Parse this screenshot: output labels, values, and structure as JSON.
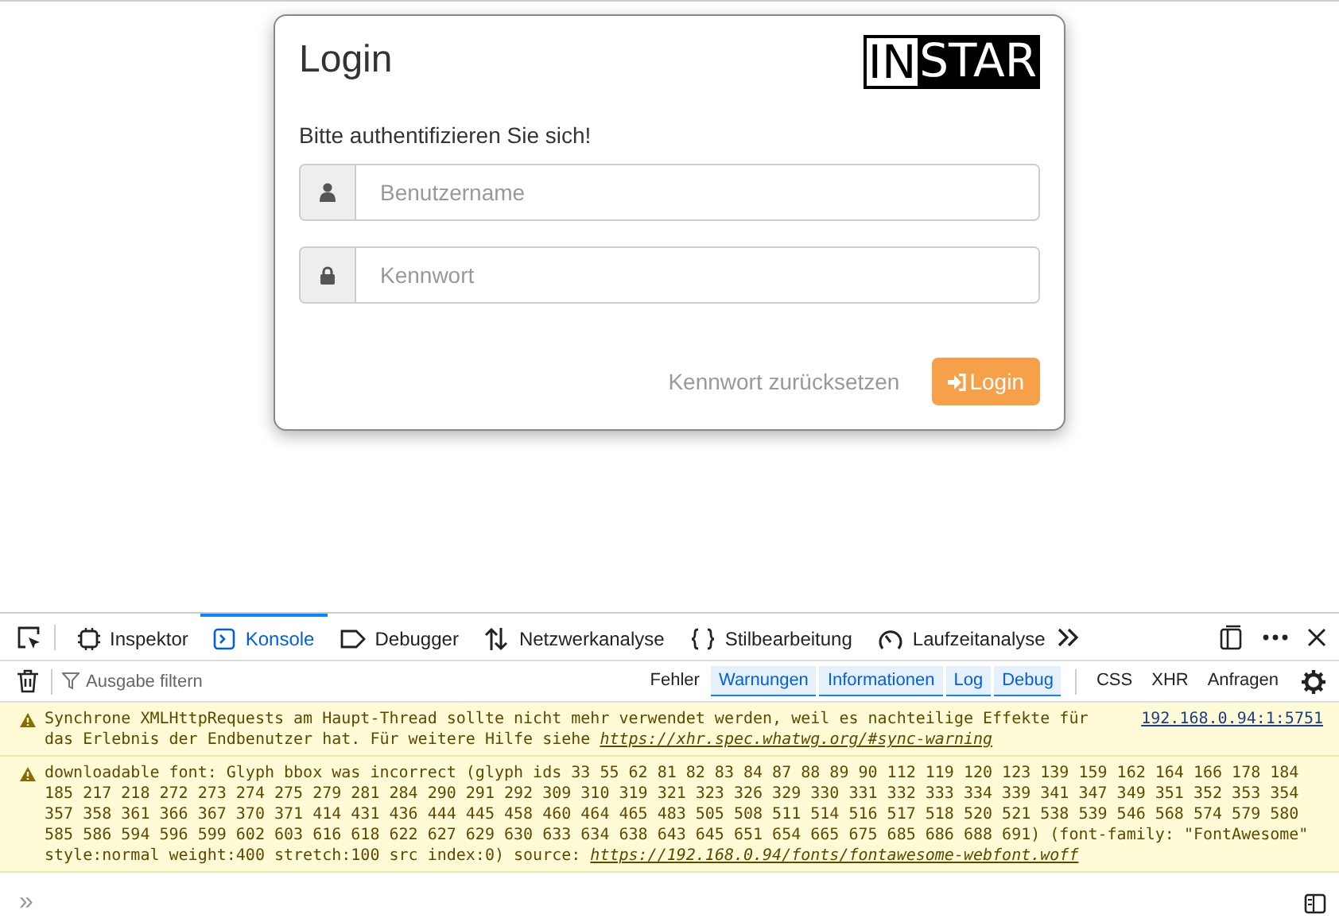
{
  "login": {
    "title": "Login",
    "logo": {
      "boxed": "IN",
      "inverted": "STAR"
    },
    "prompt": "Bitte authentifizieren Sie sich!",
    "fields": [
      {
        "kind": "user",
        "placeholder": "Benutzername"
      },
      {
        "kind": "lock",
        "placeholder": "Kennwort"
      }
    ],
    "reset_link": "Kennwort zurücksetzen",
    "submit": "Login"
  },
  "devtools": {
    "tabs": [
      {
        "kind": "inspector",
        "label": "Inspektor",
        "selected": false
      },
      {
        "kind": "console",
        "label": "Konsole",
        "selected": true
      },
      {
        "kind": "debugger",
        "label": "Debugger",
        "selected": false
      },
      {
        "kind": "network",
        "label": "Netzwerkanalyse",
        "selected": false
      },
      {
        "kind": "style",
        "label": "Stilbearbeitung",
        "selected": false
      },
      {
        "kind": "performance",
        "label": "Laufzeitanalyse",
        "selected": false
      }
    ],
    "filter_placeholder": "Ausgabe filtern",
    "levels": [
      {
        "label": "Fehler",
        "selected": false
      },
      {
        "label": "Warnungen",
        "selected": true
      },
      {
        "label": "Informationen",
        "selected": true
      },
      {
        "label": "Log",
        "selected": true
      },
      {
        "label": "Debug",
        "selected": true
      }
    ],
    "categories": [
      {
        "label": "CSS",
        "selected": false
      },
      {
        "label": "XHR",
        "selected": false
      },
      {
        "label": "Anfragen",
        "selected": false
      }
    ],
    "messages": [
      {
        "kind": "warning",
        "text": "Synchrone XMLHttpRequests am Haupt-Thread sollte nicht mehr verwendet werden, weil es nachteilige Effekte für das Erlebnis der Endbenutzer hat. Für weitere Hilfe siehe ",
        "link": "https://xhr.spec.whatwg.org/#sync-warning",
        "source": "192.168.0.94:1:5751"
      },
      {
        "kind": "warning",
        "text": "downloadable font: Glyph bbox was incorrect (glyph ids 33 55 62 81 82 83 84 87 88 89 90 112 119 120 123 139 159 162 164 166 178 184 185 217 218 272 273 274 275 279 281 284 290 291 292 309 310 319 321 323 326 329 330 331 332 333 334 339 341 347 349 351 352 353 354 357 358 361 366 367 370 371 414 431 436 444 445 458 460 464 465 483 505 508 511 514 516 517 518 520 521 538 539 546 568 574 579 580 585 586 594 596 599 602 603 616 618 622 627 629 630 633 634 638 643 645 651 654 665 675 685 686 688 691) (font-family: \"FontAwesome\" style:normal weight:400 stretch:100 src index:0) source: ",
        "link": "https://192.168.0.94/fonts/fontawesome-webfont.woff"
      }
    ],
    "prompt_symbol": "»"
  }
}
